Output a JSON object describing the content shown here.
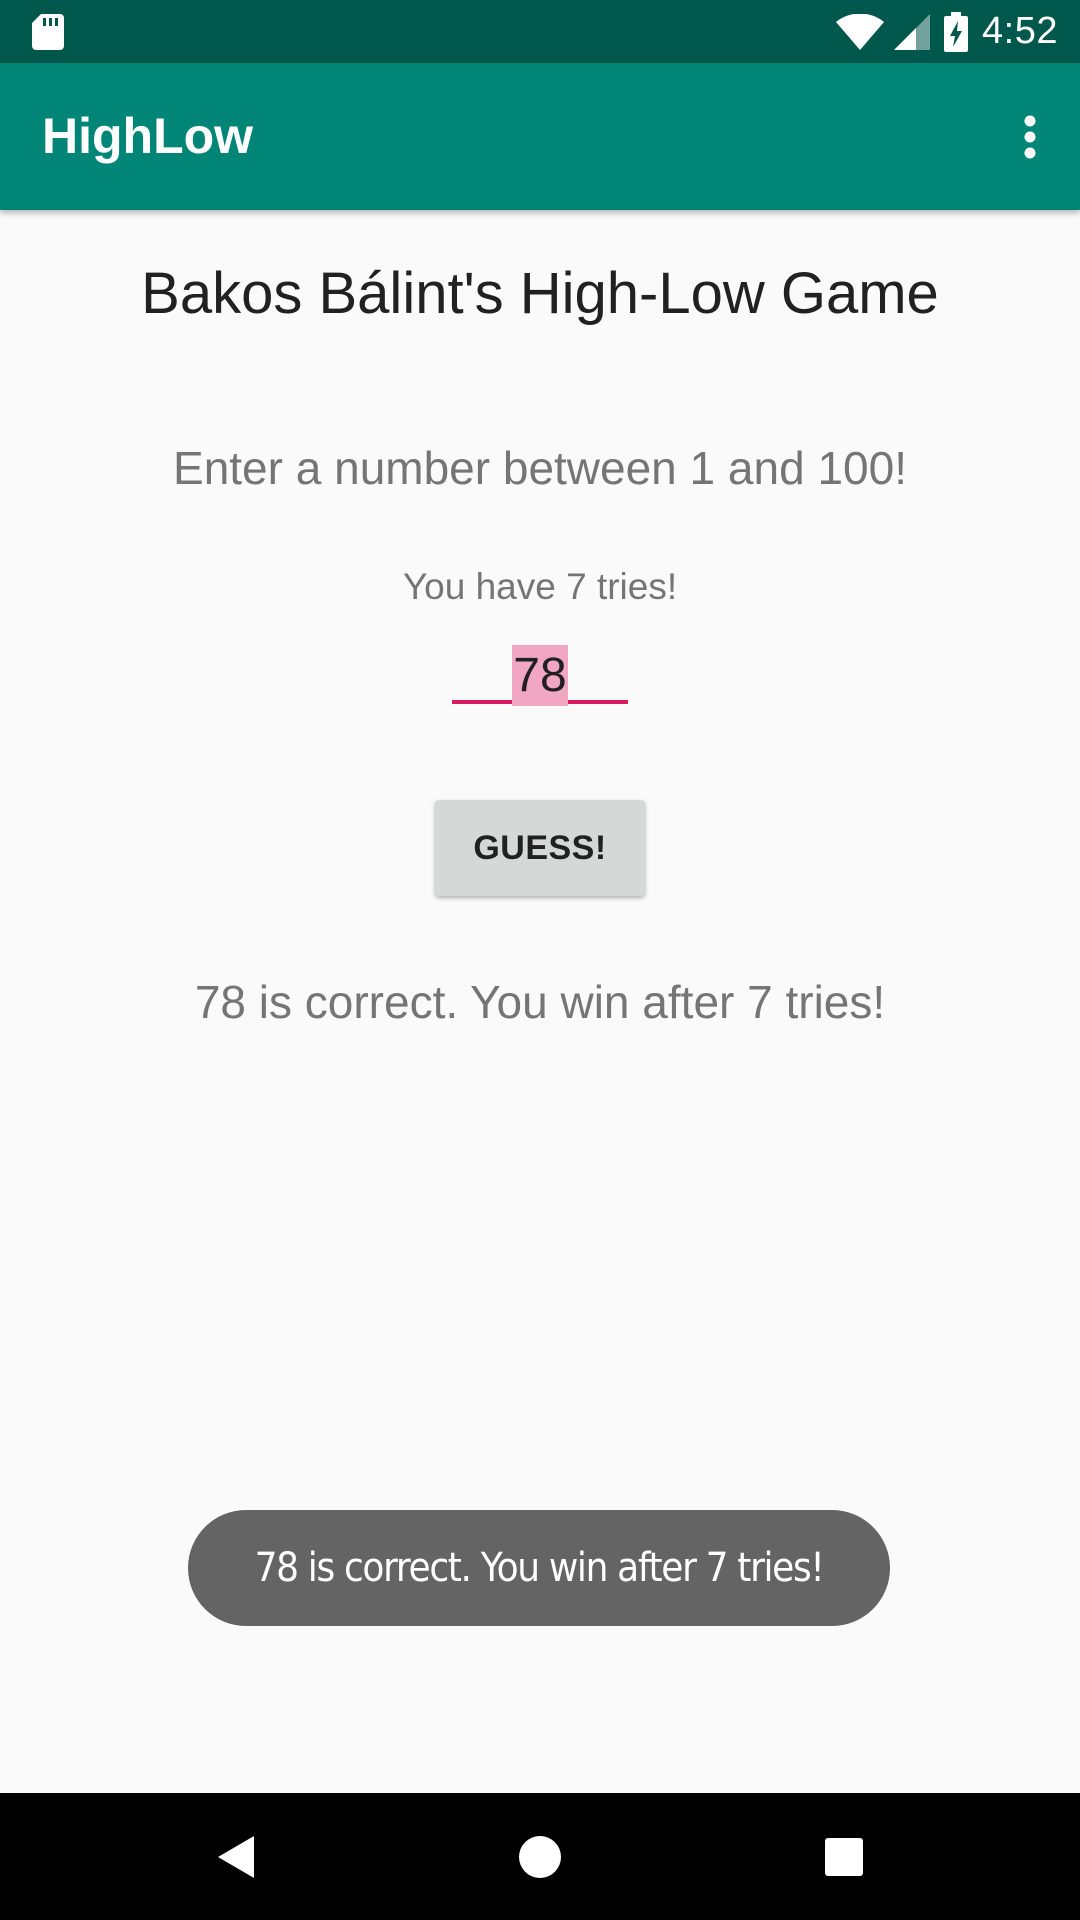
{
  "status_bar": {
    "time": "4:52",
    "icons": [
      "sd-card-icon",
      "wifi-icon",
      "signal-icon",
      "battery-charging-icon"
    ]
  },
  "app_bar": {
    "title": "HighLow",
    "overflow_icon": "more-vert-icon"
  },
  "game": {
    "title": "Bakos Bálint's High-Low Game",
    "instruction": "Enter a number between 1 and 100!",
    "tries_label": "You have 7 tries!",
    "input_value": "78",
    "guess_button_label": "GUESS!",
    "result": "78 is correct. You win after 7 tries!"
  },
  "toast": {
    "message": "78 is correct. You win after 7 tries!"
  },
  "nav_bar": {
    "buttons": [
      "back-icon",
      "home-icon",
      "recents-icon"
    ]
  },
  "colors": {
    "status_bar": "#00574b",
    "app_bar": "#008577",
    "accent": "#d81b60",
    "selection": "#f1a7c1",
    "background": "#fafafa",
    "toast": "#646464"
  }
}
